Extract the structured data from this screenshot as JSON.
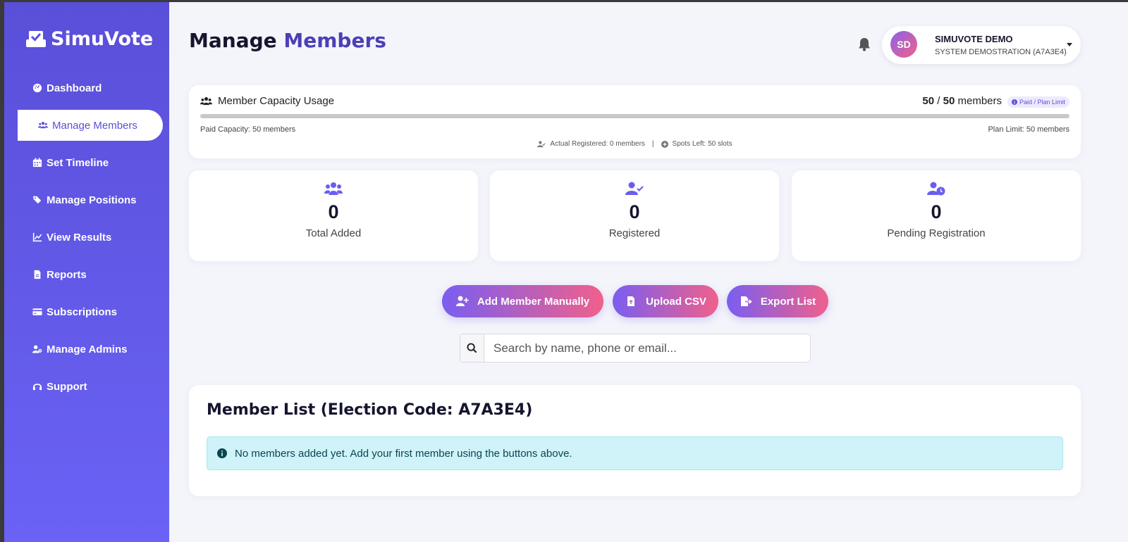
{
  "brand": {
    "name": "SimuVote"
  },
  "sidebar": {
    "items": [
      {
        "label": "Dashboard",
        "icon": "dashboard-icon",
        "active": false
      },
      {
        "label": "Manage Members",
        "icon": "users-icon",
        "active": true
      },
      {
        "label": "Set Timeline",
        "icon": "calendar-icon",
        "active": false
      },
      {
        "label": "Manage Positions",
        "icon": "tags-icon",
        "active": false
      },
      {
        "label": "View Results",
        "icon": "chart-icon",
        "active": false
      },
      {
        "label": "Reports",
        "icon": "file-icon",
        "active": false
      },
      {
        "label": "Subscriptions",
        "icon": "credit-card-icon",
        "active": false
      },
      {
        "label": "Manage Admins",
        "icon": "user-gear-icon",
        "active": false
      },
      {
        "label": "Support",
        "icon": "headset-icon",
        "active": false
      }
    ]
  },
  "header": {
    "title_main": "Manage",
    "title_accent": "Members",
    "user": {
      "initials": "SD",
      "name": "SIMUVOTE DEMO",
      "subtitle": "SYSTEM DEMOSTRATION (A7A3E4)"
    }
  },
  "capacity": {
    "title": "Member Capacity Usage",
    "used": "50",
    "separator": " / ",
    "total": "50",
    "unit": " members",
    "badge": "Paid / Plan Limit",
    "fill_fraction": 1.0,
    "paid_capacity": "Paid Capacity: 50 members",
    "plan_limit": "Plan Limit: 50 members",
    "actual_registered": "Actual Registered: 0 members",
    "divider": "|",
    "spots_left": "Spots Left: 50 slots"
  },
  "stats": [
    {
      "value": "0",
      "label": "Total Added",
      "icon": "users-icon"
    },
    {
      "value": "0",
      "label": "Registered",
      "icon": "user-check-icon"
    },
    {
      "value": "0",
      "label": "Pending Registration",
      "icon": "user-clock-icon"
    }
  ],
  "actions": {
    "add_label": "Add Member Manually",
    "upload_label": "Upload CSV",
    "export_label": "Export List"
  },
  "search": {
    "placeholder": "Search by name, phone or email..."
  },
  "member_list": {
    "title": "Member List (Election Code: A7A3E4)",
    "empty_message": "No members added yet. Add your first member using the buttons above."
  },
  "colors": {
    "sidebar_top": "#5a4fd9",
    "sidebar_bottom": "#6a62f5",
    "accent": "#4b3fb6",
    "button_gradient_start": "#7a5ef0",
    "button_gradient_end": "#f0608b",
    "alert_bg": "#cff3f9"
  }
}
